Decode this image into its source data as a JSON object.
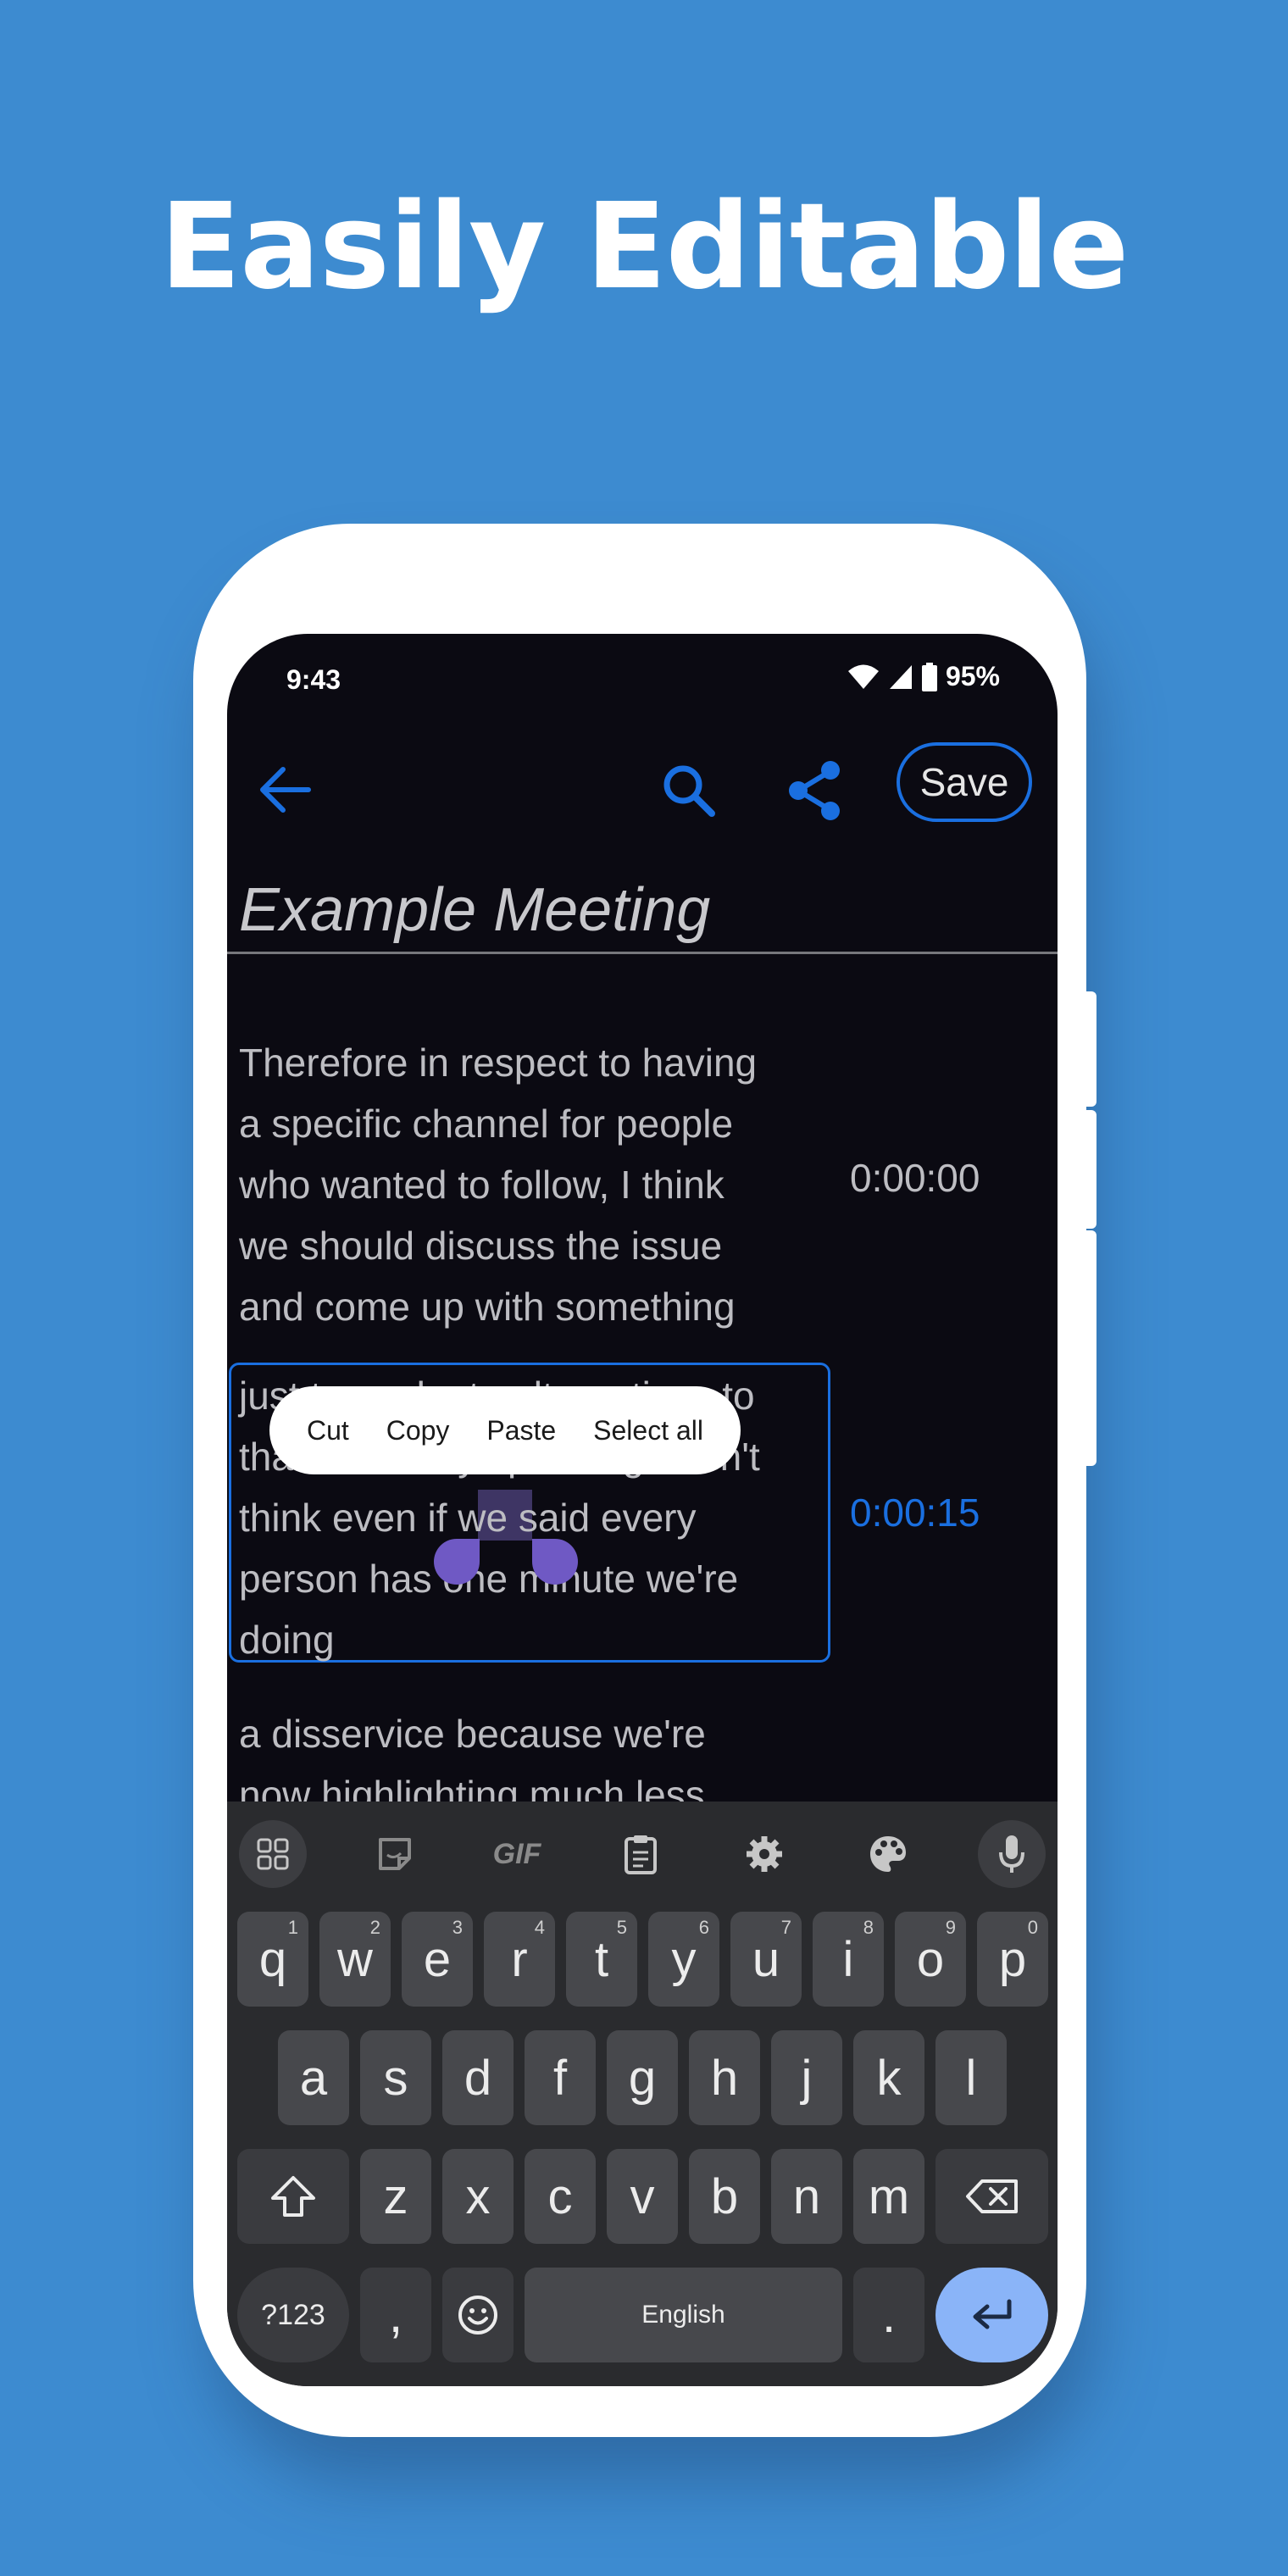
{
  "headline": "Easily Editable",
  "status": {
    "time": "9:43",
    "battery": "95%"
  },
  "appbar": {
    "save_label": "Save"
  },
  "note": {
    "title": "Example Meeting"
  },
  "transcript": [
    {
      "lines": [
        "Therefore in respect to having",
        "a specific channel for people",
        "who wanted to follow, I think",
        "we should discuss the issue",
        "and come up with something"
      ],
      "timestamp": "0:00:00"
    },
    {
      "lines": [
        "just to evaluate alternatives to",
        "that. Honestly speaking I don't",
        "think even if we said every",
        "person has one minute we're",
        "doing"
      ],
      "timestamp": "0:00:15"
    },
    {
      "lines": [
        "a disservice because we're",
        "now highlighting much less"
      ],
      "timestamp": ""
    }
  ],
  "context_menu": [
    "Cut",
    "Copy",
    "Paste",
    "Select all"
  ],
  "keyboard": {
    "toolbar_gif": "GIF",
    "row1": [
      {
        "k": "q",
        "h": "1"
      },
      {
        "k": "w",
        "h": "2"
      },
      {
        "k": "e",
        "h": "3"
      },
      {
        "k": "r",
        "h": "4"
      },
      {
        "k": "t",
        "h": "5"
      },
      {
        "k": "y",
        "h": "6"
      },
      {
        "k": "u",
        "h": "7"
      },
      {
        "k": "i",
        "h": "8"
      },
      {
        "k": "o",
        "h": "9"
      },
      {
        "k": "p",
        "h": "0"
      }
    ],
    "row2": [
      "a",
      "s",
      "d",
      "f",
      "g",
      "h",
      "j",
      "k",
      "l"
    ],
    "row3": [
      "z",
      "x",
      "c",
      "v",
      "b",
      "n",
      "m"
    ],
    "symbols": "?123",
    "comma": ",",
    "space": "English",
    "period": "."
  },
  "colors": {
    "background": "#3d8bd0",
    "accent": "#1a6fe0",
    "screen": "#0b0a12",
    "selection_handle": "#6f59c4",
    "enter_key": "#8ab4f8"
  }
}
